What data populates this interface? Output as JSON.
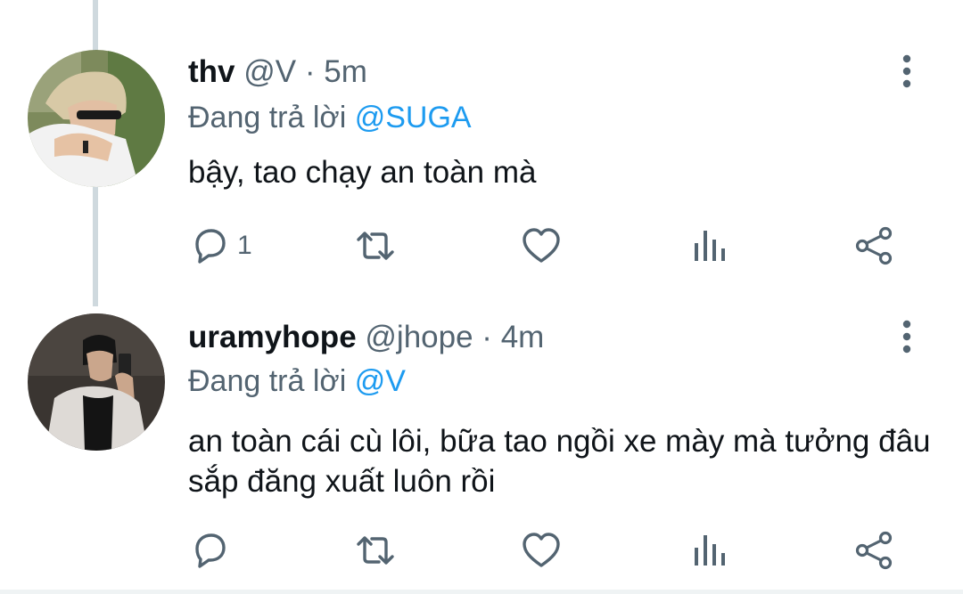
{
  "tweets": [
    {
      "name": "thv",
      "handle": "@V",
      "separator": "·",
      "time": "5m",
      "reply_prefix": "Đang trả lời",
      "reply_to": "@SUGA",
      "text": "bậy, tao chạy an toàn mà",
      "reply_count": "1",
      "icons": [
        "reply-icon",
        "retweet-icon",
        "like-icon",
        "views-icon",
        "share-icon",
        "more-icon"
      ]
    },
    {
      "name": "uramyhope",
      "handle": "@jhope",
      "separator": "·",
      "time": "4m",
      "reply_prefix": "Đang trả lời",
      "reply_to": "@V",
      "text": "an toàn cái cù lôi, bữa tao ngồi xe mày mà tưởng đâu sắp đăng xuất luôn rồi",
      "reply_count": "",
      "icons": [
        "reply-icon",
        "retweet-icon",
        "like-icon",
        "views-icon",
        "share-icon",
        "more-icon"
      ]
    }
  ],
  "colors": {
    "text_primary": "#0f1419",
    "text_secondary": "#536471",
    "mention": "#1d9bf0",
    "thread_line": "#cfd9de"
  }
}
